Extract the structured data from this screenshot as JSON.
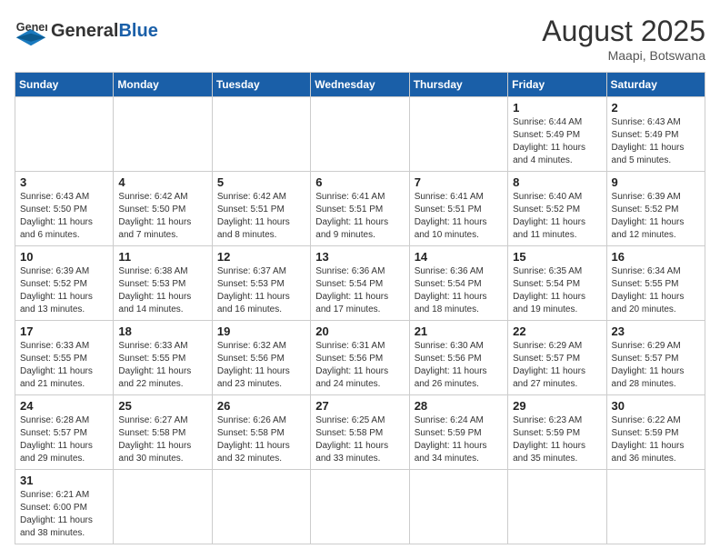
{
  "logo": {
    "text_general": "General",
    "text_blue": "Blue"
  },
  "title": {
    "month_year": "August 2025",
    "location": "Maapi, Botswana"
  },
  "weekdays": [
    "Sunday",
    "Monday",
    "Tuesday",
    "Wednesday",
    "Thursday",
    "Friday",
    "Saturday"
  ],
  "weeks": [
    [
      null,
      null,
      null,
      null,
      null,
      {
        "day": "1",
        "sunrise": "6:44 AM",
        "sunset": "5:49 PM",
        "daylight_hours": "11",
        "daylight_minutes": "4"
      },
      {
        "day": "2",
        "sunrise": "6:43 AM",
        "sunset": "5:49 PM",
        "daylight_hours": "11",
        "daylight_minutes": "5"
      }
    ],
    [
      {
        "day": "3",
        "sunrise": "6:43 AM",
        "sunset": "5:50 PM",
        "daylight_hours": "11",
        "daylight_minutes": "6"
      },
      {
        "day": "4",
        "sunrise": "6:42 AM",
        "sunset": "5:50 PM",
        "daylight_hours": "11",
        "daylight_minutes": "7"
      },
      {
        "day": "5",
        "sunrise": "6:42 AM",
        "sunset": "5:51 PM",
        "daylight_hours": "11",
        "daylight_minutes": "8"
      },
      {
        "day": "6",
        "sunrise": "6:41 AM",
        "sunset": "5:51 PM",
        "daylight_hours": "11",
        "daylight_minutes": "9"
      },
      {
        "day": "7",
        "sunrise": "6:41 AM",
        "sunset": "5:51 PM",
        "daylight_hours": "11",
        "daylight_minutes": "10"
      },
      {
        "day": "8",
        "sunrise": "6:40 AM",
        "sunset": "5:52 PM",
        "daylight_hours": "11",
        "daylight_minutes": "11"
      },
      {
        "day": "9",
        "sunrise": "6:39 AM",
        "sunset": "5:52 PM",
        "daylight_hours": "11",
        "daylight_minutes": "12"
      }
    ],
    [
      {
        "day": "10",
        "sunrise": "6:39 AM",
        "sunset": "5:52 PM",
        "daylight_hours": "11",
        "daylight_minutes": "13"
      },
      {
        "day": "11",
        "sunrise": "6:38 AM",
        "sunset": "5:53 PM",
        "daylight_hours": "11",
        "daylight_minutes": "14"
      },
      {
        "day": "12",
        "sunrise": "6:37 AM",
        "sunset": "5:53 PM",
        "daylight_hours": "11",
        "daylight_minutes": "16"
      },
      {
        "day": "13",
        "sunrise": "6:36 AM",
        "sunset": "5:54 PM",
        "daylight_hours": "11",
        "daylight_minutes": "17"
      },
      {
        "day": "14",
        "sunrise": "6:36 AM",
        "sunset": "5:54 PM",
        "daylight_hours": "11",
        "daylight_minutes": "18"
      },
      {
        "day": "15",
        "sunrise": "6:35 AM",
        "sunset": "5:54 PM",
        "daylight_hours": "11",
        "daylight_minutes": "19"
      },
      {
        "day": "16",
        "sunrise": "6:34 AM",
        "sunset": "5:55 PM",
        "daylight_hours": "11",
        "daylight_minutes": "20"
      }
    ],
    [
      {
        "day": "17",
        "sunrise": "6:33 AM",
        "sunset": "5:55 PM",
        "daylight_hours": "11",
        "daylight_minutes": "21"
      },
      {
        "day": "18",
        "sunrise": "6:33 AM",
        "sunset": "5:55 PM",
        "daylight_hours": "11",
        "daylight_minutes": "22"
      },
      {
        "day": "19",
        "sunrise": "6:32 AM",
        "sunset": "5:56 PM",
        "daylight_hours": "11",
        "daylight_minutes": "23"
      },
      {
        "day": "20",
        "sunrise": "6:31 AM",
        "sunset": "5:56 PM",
        "daylight_hours": "11",
        "daylight_minutes": "24"
      },
      {
        "day": "21",
        "sunrise": "6:30 AM",
        "sunset": "5:56 PM",
        "daylight_hours": "11",
        "daylight_minutes": "26"
      },
      {
        "day": "22",
        "sunrise": "6:29 AM",
        "sunset": "5:57 PM",
        "daylight_hours": "11",
        "daylight_minutes": "27"
      },
      {
        "day": "23",
        "sunrise": "6:29 AM",
        "sunset": "5:57 PM",
        "daylight_hours": "11",
        "daylight_minutes": "28"
      }
    ],
    [
      {
        "day": "24",
        "sunrise": "6:28 AM",
        "sunset": "5:57 PM",
        "daylight_hours": "11",
        "daylight_minutes": "29"
      },
      {
        "day": "25",
        "sunrise": "6:27 AM",
        "sunset": "5:58 PM",
        "daylight_hours": "11",
        "daylight_minutes": "30"
      },
      {
        "day": "26",
        "sunrise": "6:26 AM",
        "sunset": "5:58 PM",
        "daylight_hours": "11",
        "daylight_minutes": "32"
      },
      {
        "day": "27",
        "sunrise": "6:25 AM",
        "sunset": "5:58 PM",
        "daylight_hours": "11",
        "daylight_minutes": "33"
      },
      {
        "day": "28",
        "sunrise": "6:24 AM",
        "sunset": "5:59 PM",
        "daylight_hours": "11",
        "daylight_minutes": "34"
      },
      {
        "day": "29",
        "sunrise": "6:23 AM",
        "sunset": "5:59 PM",
        "daylight_hours": "11",
        "daylight_minutes": "35"
      },
      {
        "day": "30",
        "sunrise": "6:22 AM",
        "sunset": "5:59 PM",
        "daylight_hours": "11",
        "daylight_minutes": "36"
      }
    ],
    [
      {
        "day": "31",
        "sunrise": "6:21 AM",
        "sunset": "6:00 PM",
        "daylight_hours": "11",
        "daylight_minutes": "38"
      },
      null,
      null,
      null,
      null,
      null,
      null
    ]
  ],
  "labels": {
    "sunrise": "Sunrise:",
    "sunset": "Sunset:",
    "daylight": "Daylight: {h} hours and {m} minutes."
  }
}
